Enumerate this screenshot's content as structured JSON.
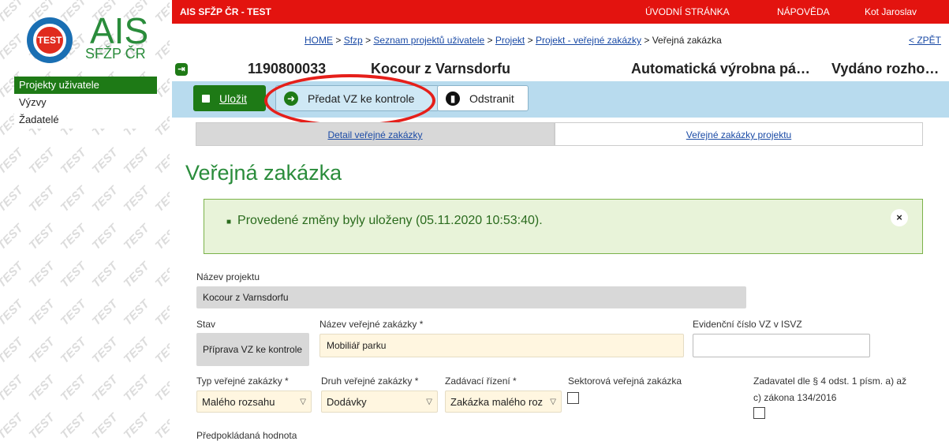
{
  "logo": {
    "badge": "TEST",
    "name": "AIS",
    "sub": "SFŽP ČR"
  },
  "watermark": "TEST",
  "sidebar": {
    "items": [
      {
        "label": "Projekty uživatele",
        "active": true
      },
      {
        "label": "Výzvy",
        "active": false
      },
      {
        "label": "Žadatelé",
        "active": false
      }
    ]
  },
  "topbar": {
    "title": "AIS SFŽP ČR - TEST",
    "home": "ÚVODNÍ STRÁNKA",
    "help": "NÁPOVĚDA",
    "user": "Kot Jaroslav",
    "color": "#e3130f"
  },
  "breadcrumb": {
    "items": [
      "HOME",
      "Sfzp",
      "Seznam projektů uživatele",
      "Projekt",
      "Projekt - veřejné zakázky"
    ],
    "current": "Veřejná zakázka",
    "separator": ">",
    "back": "< ZPĚT"
  },
  "project_header": {
    "number": "1190800033",
    "name": "Kocour z Varnsdorfu",
    "title": "Automatická výrobna pá…",
    "status": "Vydáno rozho…"
  },
  "toolbar": {
    "save": "Uložit",
    "pass": "Předat VZ ke kontrole",
    "delete": "Odstranit"
  },
  "tabs": {
    "detail": "Detail veřejné zakázky",
    "list": "Veřejné zakázky projektu"
  },
  "page": {
    "title": "Veřejná zakázka"
  },
  "message": {
    "text": "Provedené změny byly uloženy (05.11.2020 10:53:40).",
    "close": "×"
  },
  "form": {
    "project_name_label": "Název projektu",
    "project_name_value": "Kocour z Varnsdorfu",
    "state_label": "Stav",
    "state_value": "Příprava VZ ke kontrole",
    "vz_name_label": "Název veřejné zakázky *",
    "vz_name_value": "Mobiliář parku",
    "isvz_label": "Evidenční číslo VZ v ISVZ",
    "isvz_value": "",
    "type_label": "Typ veřejné zakázky *",
    "type_value": "Malého rozsahu",
    "kind_label": "Druh veřejné zakázky *",
    "kind_value": "Dodávky",
    "procedure_label": "Zadávací řízení *",
    "procedure_value": "Zakázka malého roz",
    "sector_label": "Sektorová veřejná zakázka",
    "sector_checked": false,
    "contractor_label_1": "Zadavatel dle § 4 odst. 1 písm. a) až",
    "contractor_label_2": "c) zákona 134/2016",
    "contractor_checked": false,
    "estimated_label": "Předpokládaná hodnota"
  },
  "colors": {
    "accent_green": "#1e7a16",
    "toolbar_blue": "#b8dbee",
    "highlight": "#e51f1a"
  }
}
